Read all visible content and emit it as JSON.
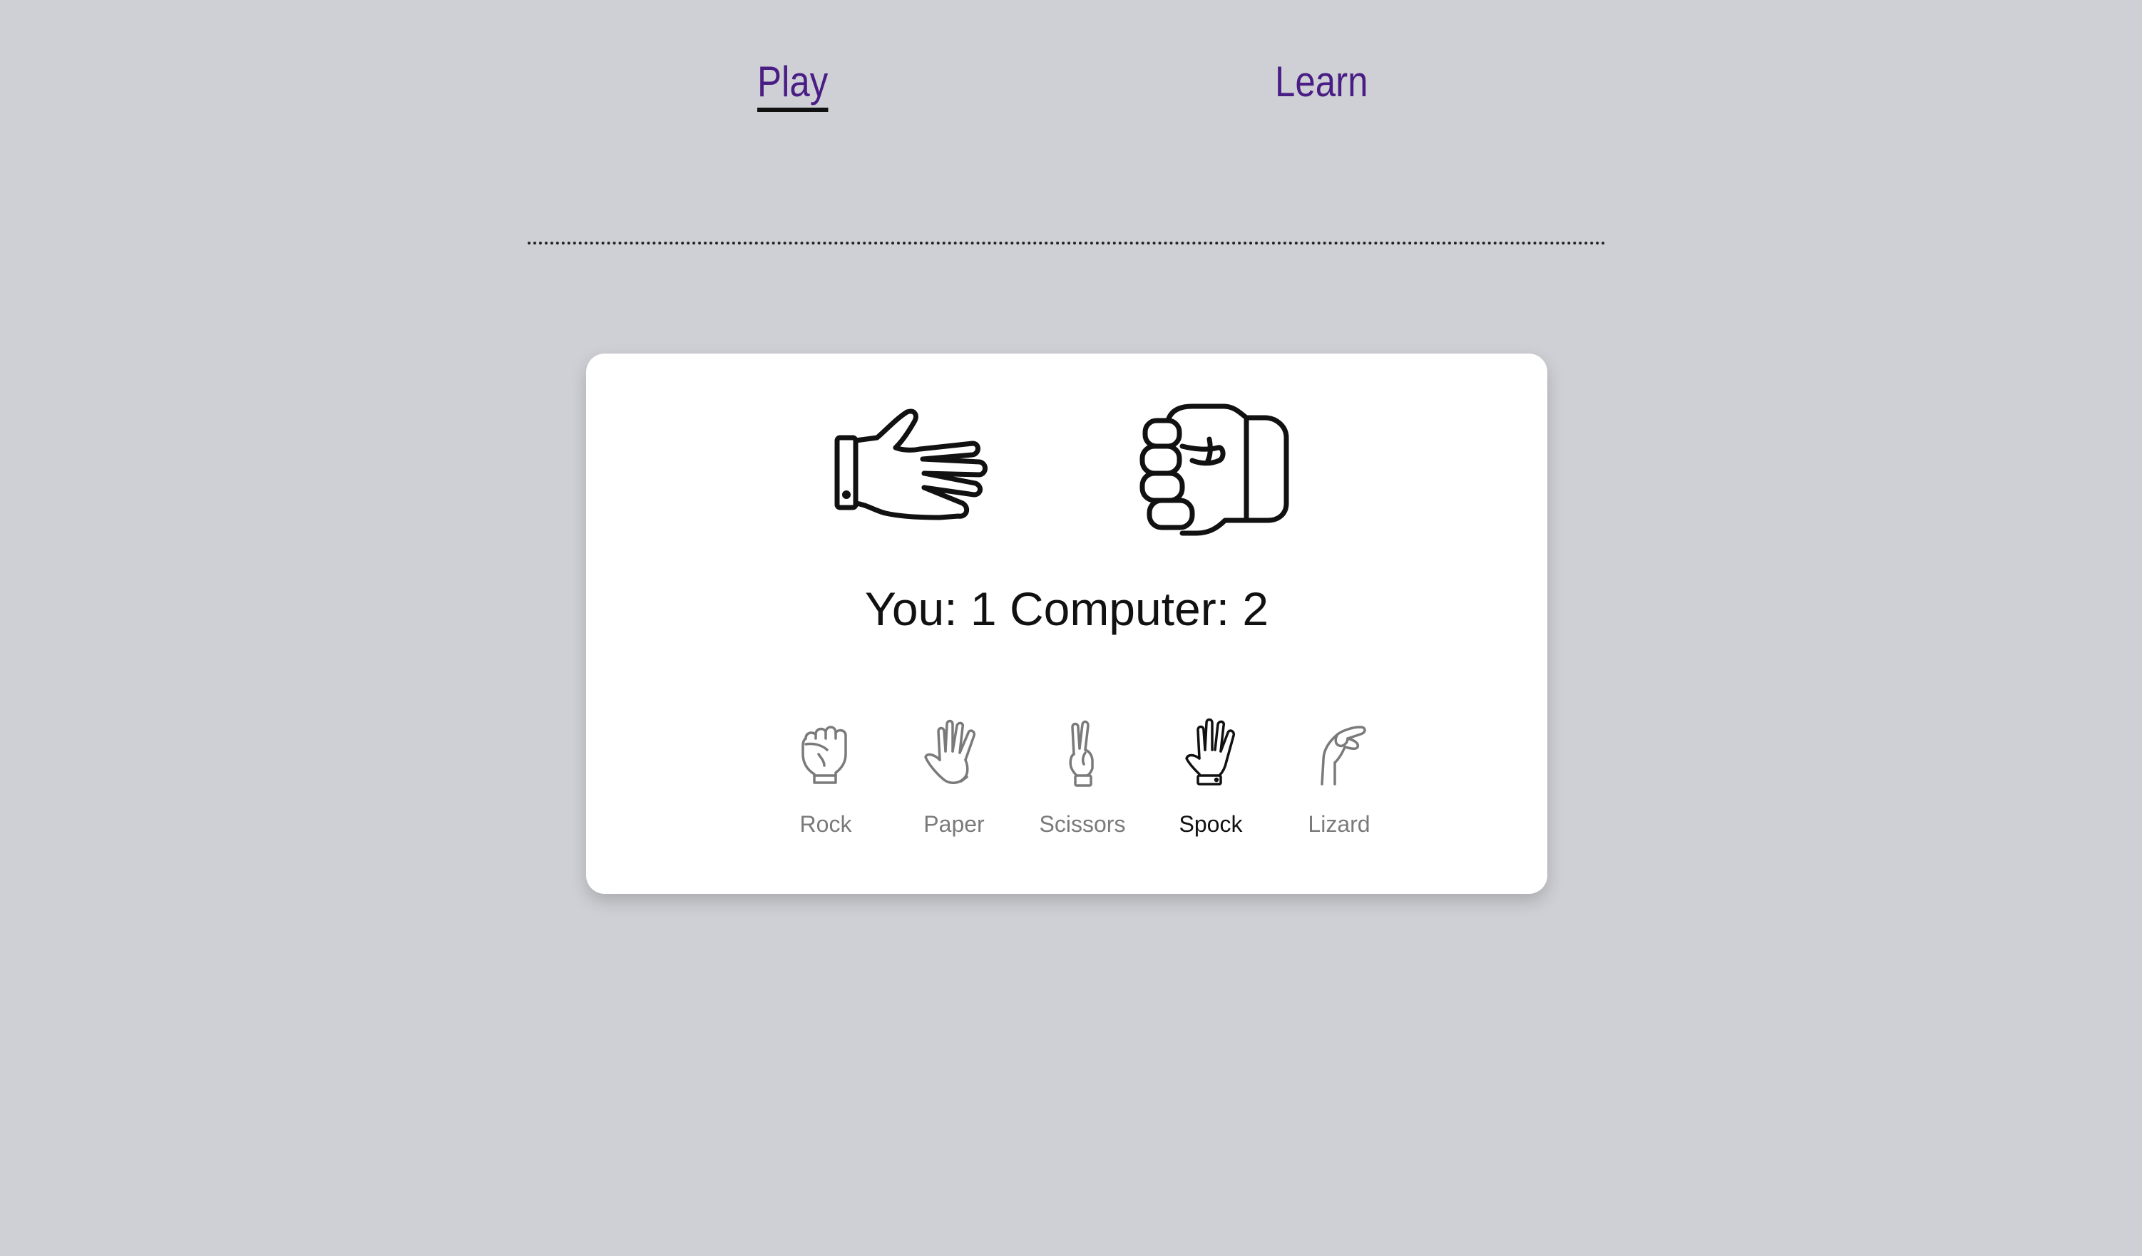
{
  "nav": {
    "play_label": "Play",
    "learn_label": "Learn",
    "active": "Play"
  },
  "round": {
    "player_hand_icon": "paper-hand-icon",
    "computer_hand_icon": "rock-fist-icon"
  },
  "score": {
    "text": "You: 1 Computer: 2",
    "you": 1,
    "computer": 2
  },
  "choices": [
    {
      "label": "Rock",
      "icon": "rock-icon",
      "selected": false
    },
    {
      "label": "Paper",
      "icon": "paper-icon",
      "selected": false
    },
    {
      "label": "Scissors",
      "icon": "scissors-icon",
      "selected": false
    },
    {
      "label": "Spock",
      "icon": "spock-icon",
      "selected": true
    },
    {
      "label": "Lizard",
      "icon": "lizard-icon",
      "selected": false
    }
  ],
  "colors": {
    "background": "#cfd0d5",
    "card": "#ffffff",
    "nav_link": "#4a1d85",
    "icon_inactive": "#7a7a7a",
    "icon_active": "#111111"
  }
}
